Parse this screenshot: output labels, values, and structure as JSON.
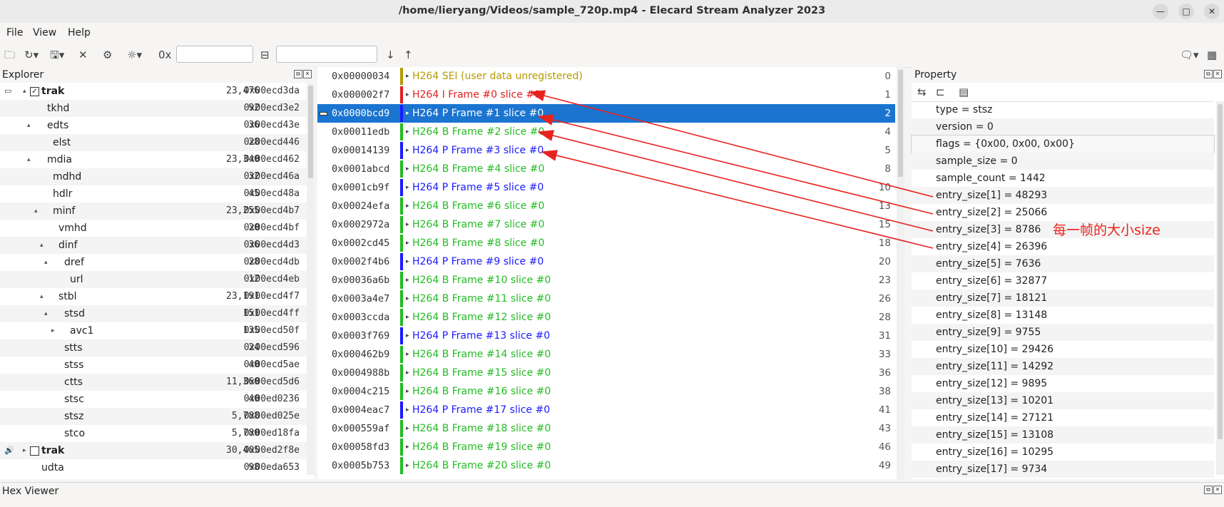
{
  "window": {
    "title": "/home/lieryang/Videos/sample_720p.mp4 - Elecard Stream Analyzer 2023"
  },
  "menu": [
    "File",
    "View",
    "Help"
  ],
  "explorer": {
    "title": "Explorer",
    "rows": [
      {
        "name": "trak",
        "size": "23,476",
        "offset": "0x00ecd3da",
        "bold": true,
        "checked": true
      },
      {
        "name": "tkhd",
        "size": "92",
        "offset": "0x00ecd3e2"
      },
      {
        "name": "edts",
        "size": "36",
        "offset": "0x00ecd43e"
      },
      {
        "name": "elst",
        "size": "28",
        "offset": "0x00ecd446"
      },
      {
        "name": "mdia",
        "size": "23,340",
        "offset": "0x00ecd462"
      },
      {
        "name": "mdhd",
        "size": "32",
        "offset": "0x00ecd46a"
      },
      {
        "name": "hdlr",
        "size": "45",
        "offset": "0x00ecd48a"
      },
      {
        "name": "minf",
        "size": "23,255",
        "offset": "0x00ecd4b7"
      },
      {
        "name": "vmhd",
        "size": "20",
        "offset": "0x00ecd4bf"
      },
      {
        "name": "dinf",
        "size": "36",
        "offset": "0x00ecd4d3"
      },
      {
        "name": "dref",
        "size": "28",
        "offset": "0x00ecd4db"
      },
      {
        "name": "url",
        "size": "12",
        "offset": "0x00ecd4eb"
      },
      {
        "name": "stbl",
        "size": "23,191",
        "offset": "0x00ecd4f7"
      },
      {
        "name": "stsd",
        "size": "151",
        "offset": "0x00ecd4ff"
      },
      {
        "name": "avc1",
        "size": "135",
        "offset": "0x00ecd50f"
      },
      {
        "name": "stts",
        "size": "24",
        "offset": "0x00ecd596"
      },
      {
        "name": "stss",
        "size": "40",
        "offset": "0x00ecd5ae"
      },
      {
        "name": "ctts",
        "size": "11,360",
        "offset": "0x00ecd5d6"
      },
      {
        "name": "stsc",
        "size": "40",
        "offset": "0x00ed0236"
      },
      {
        "name": "stsz",
        "size": "5,788",
        "offset": "0x00ed025e"
      },
      {
        "name": "stco",
        "size": "5,780",
        "offset": "0x00ed18fa"
      },
      {
        "name": "trak",
        "size": "30,405",
        "offset": "0x00ed2f8e",
        "bold": true,
        "checked": false
      },
      {
        "name": "udta",
        "size": "98",
        "offset": "0x00eda653"
      }
    ]
  },
  "frames": [
    {
      "addr": "0x00000034",
      "name": "H264 SEI (user data unregistered)",
      "num": "0",
      "color": "#b59b00"
    },
    {
      "addr": "0x000002f7",
      "name": "H264 I Frame #0 slice #0",
      "num": "1",
      "color": "#e02020"
    },
    {
      "addr": "0x0000bcd9",
      "name": "H264 P Frame #1 slice #0",
      "num": "2",
      "color": "#1a1aff",
      "selected": true
    },
    {
      "addr": "0x00011edb",
      "name": "H264 B Frame #2 slice #0",
      "num": "4",
      "color": "#22bb22"
    },
    {
      "addr": "0x00014139",
      "name": "H264 P Frame #3 slice #0",
      "num": "5",
      "color": "#1a1aff"
    },
    {
      "addr": "0x0001abcd",
      "name": "H264 B Frame #4 slice #0",
      "num": "8",
      "color": "#22bb22"
    },
    {
      "addr": "0x0001cb9f",
      "name": "H264 P Frame #5 slice #0",
      "num": "10",
      "color": "#1a1aff"
    },
    {
      "addr": "0x00024efa",
      "name": "H264 B Frame #6 slice #0",
      "num": "13",
      "color": "#22bb22"
    },
    {
      "addr": "0x0002972a",
      "name": "H264 B Frame #7 slice #0",
      "num": "15",
      "color": "#22bb22"
    },
    {
      "addr": "0x0002cd45",
      "name": "H264 B Frame #8 slice #0",
      "num": "18",
      "color": "#22bb22"
    },
    {
      "addr": "0x0002f4b6",
      "name": "H264 P Frame #9 slice #0",
      "num": "20",
      "color": "#1a1aff"
    },
    {
      "addr": "0x00036a6b",
      "name": "H264 B Frame #10 slice #0",
      "num": "23",
      "color": "#22bb22"
    },
    {
      "addr": "0x0003a4e7",
      "name": "H264 B Frame #11 slice #0",
      "num": "26",
      "color": "#22bb22"
    },
    {
      "addr": "0x0003ccda",
      "name": "H264 B Frame #12 slice #0",
      "num": "28",
      "color": "#22bb22"
    },
    {
      "addr": "0x0003f769",
      "name": "H264 P Frame #13 slice #0",
      "num": "31",
      "color": "#1a1aff"
    },
    {
      "addr": "0x000462b9",
      "name": "H264 B Frame #14 slice #0",
      "num": "33",
      "color": "#22bb22"
    },
    {
      "addr": "0x0004988b",
      "name": "H264 B Frame #15 slice #0",
      "num": "36",
      "color": "#22bb22"
    },
    {
      "addr": "0x0004c215",
      "name": "H264 B Frame #16 slice #0",
      "num": "38",
      "color": "#22bb22"
    },
    {
      "addr": "0x0004eac7",
      "name": "H264 P Frame #17 slice #0",
      "num": "41",
      "color": "#1a1aff"
    },
    {
      "addr": "0x000559af",
      "name": "H264 B Frame #18 slice #0",
      "num": "43",
      "color": "#22bb22"
    },
    {
      "addr": "0x00058fd3",
      "name": "H264 B Frame #19 slice #0",
      "num": "46",
      "color": "#22bb22"
    },
    {
      "addr": "0x0005b753",
      "name": "H264 B Frame #20 slice #0",
      "num": "49",
      "color": "#22bb22"
    }
  ],
  "property": {
    "title": "Property",
    "rows": [
      "type = stsz",
      "version = 0",
      "flags = {0x00, 0x00, 0x00}",
      "sample_size = 0",
      "sample_count = 1442",
      "entry_size[1] = 48293",
      "entry_size[2] = 25066",
      "entry_size[3] = 8786",
      "entry_size[4] = 26396",
      "entry_size[5] = 7636",
      "entry_size[6] = 32877",
      "entry_size[7] = 18121",
      "entry_size[8] = 13148",
      "entry_size[9] = 9755",
      "entry_size[10] = 29426",
      "entry_size[11] = 14292",
      "entry_size[12] = 9895",
      "entry_size[13] = 10201",
      "entry_size[14] = 27121",
      "entry_size[15] = 13108",
      "entry_size[16] = 10295",
      "entry_size[17] = 9734"
    ]
  },
  "annotation": "每一帧的大小size",
  "hexviewer": {
    "title": "Hex Viewer"
  },
  "colors": {
    "selection": "#1a74d0",
    "annotation": "#e8231f",
    "i_frame": "#e02020",
    "p_frame": "#1a1aff",
    "b_frame": "#22bb22",
    "sei": "#b59b00"
  }
}
